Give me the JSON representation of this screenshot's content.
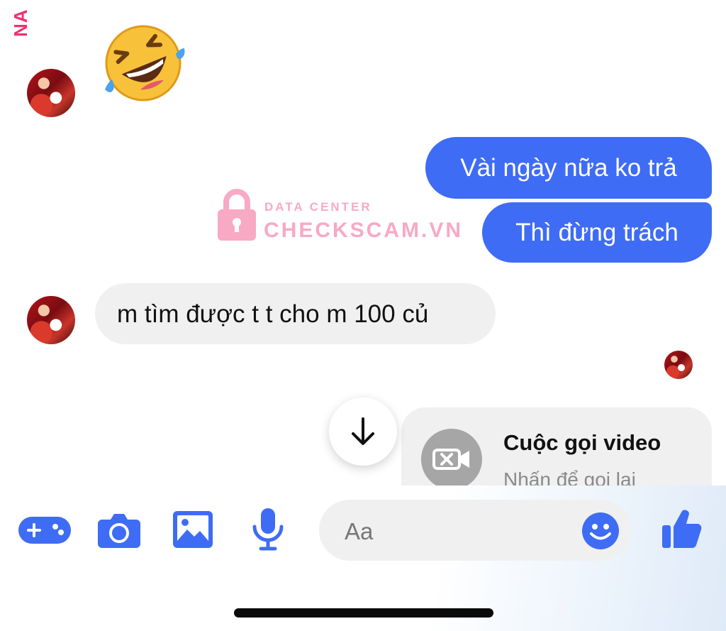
{
  "edge_label": "NA",
  "reaction_emoji": "rolling-on-floor-laughing",
  "messages": [
    {
      "side": "outgoing",
      "text": "Vài ngày nữa ko trả"
    },
    {
      "side": "outgoing",
      "text": "Thì đừng trách"
    },
    {
      "side": "incoming",
      "text": "m tìm được t t cho m 100 củ"
    }
  ],
  "watermark": {
    "top": "DATA CENTER",
    "main": "CHECKSCAM.VN"
  },
  "call": {
    "title": "Cuộc gọi video",
    "subtitle": "Nhấn để gọi lại",
    "icon": "video-camera-off-icon"
  },
  "composer": {
    "placeholder": "Aa",
    "icons": [
      "games-icon",
      "camera-icon",
      "photo-icon",
      "microphone-icon",
      "emoji-icon",
      "thumbs-up-icon"
    ]
  },
  "colors": {
    "accent": "#3f6cf4",
    "incoming_bubble": "#f0f0f0",
    "watermark": "#f8a9c4"
  }
}
